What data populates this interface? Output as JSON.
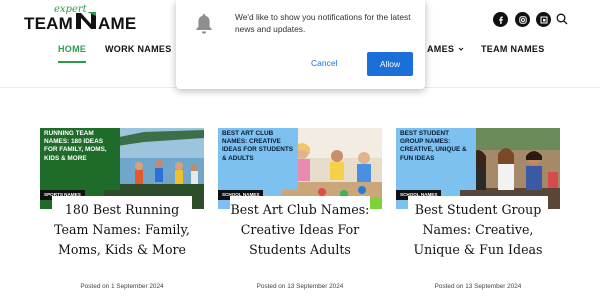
{
  "logo": {
    "tagline": "expert",
    "left_word": "TEAM",
    "right_word": "AME"
  },
  "nav": {
    "items": [
      {
        "label": "HOME",
        "active": true
      },
      {
        "label": "WORK NAMES",
        "active": false
      },
      {
        "label": "AMES",
        "active": false
      },
      {
        "label": "TEAM NAMES",
        "active": false
      }
    ]
  },
  "header_icons": [
    "facebook-icon",
    "instagram-icon",
    "flipboard-icon",
    "search-icon"
  ],
  "notification": {
    "message": "We'd like to show you notifications for the latest news and updates.",
    "cancel_label": "Cancel",
    "allow_label": "Allow"
  },
  "posts": [
    {
      "overlay": "RUNNING TEAM NAMES: 180 IDEAS FOR FAMILY, MOMS, KIDS & MORE",
      "category": "SPORTS NAMES",
      "title": "180 Best Running Team Names: Family, Moms, Kids & More",
      "date": "Posted on 1 September 2024",
      "overlay_bg": "#1f6b2a",
      "overlay_fg": "#ffffff"
    },
    {
      "overlay": "BEST ART CLUB NAMES: CREATIVE IDEAS FOR STUDENTS & ADULTS",
      "category": "SCHOOL NAMES",
      "title": "Best Art Club Names: Creative Ideas For Students Adults",
      "date": "Posted on 13 September 2024",
      "overlay_bg": "#7cc1ef",
      "overlay_fg": "#0a1a33"
    },
    {
      "overlay": "BEST STUDENT GROUP NAMES: CREATIVE, UNIQUE & FUN IDEAS",
      "category": "SCHOOL NAMES",
      "title": "Best Student Group Names: Creative, Unique & Fun Ideas",
      "date": "Posted on 13 September 2024",
      "overlay_bg": "#7cc1ef",
      "overlay_fg": "#0a1a33"
    }
  ],
  "colors": {
    "accent": "#2d9b4c",
    "allow_button": "#1a6fd8",
    "link": "#1a73e8"
  }
}
